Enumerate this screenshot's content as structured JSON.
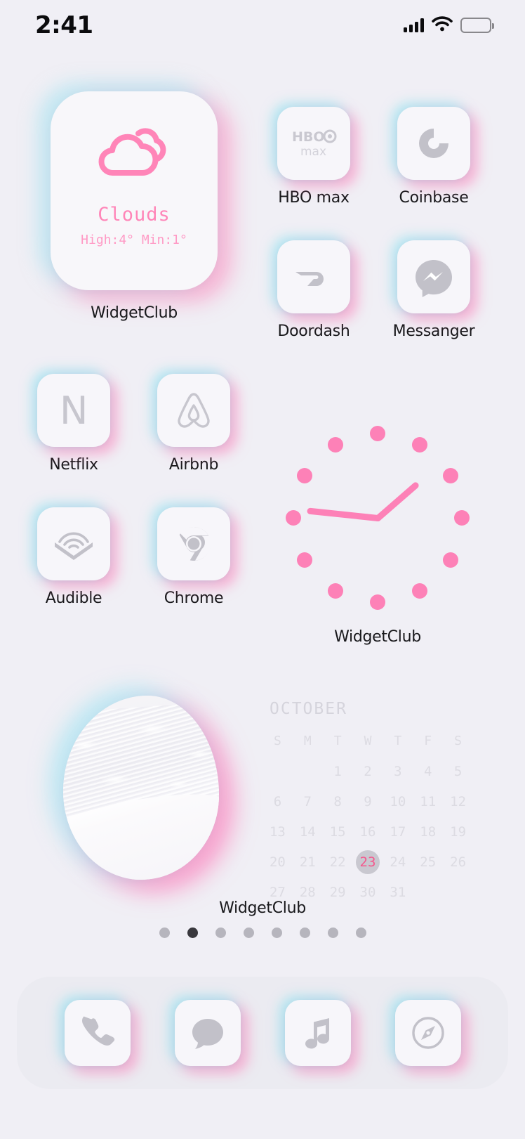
{
  "status_bar": {
    "time": "2:41",
    "signal_icon": "cellular-signal-icon",
    "wifi_icon": "wifi-icon",
    "battery_icon": "battery-icon"
  },
  "weather_widget": {
    "icon": "clouds-icon",
    "condition": "Clouds",
    "temps": "High:4° Min:1°",
    "label": "WidgetClub",
    "accent_color": "#ff85b8"
  },
  "clock_widget": {
    "label": "WidgetClub",
    "dot_color": "#fd81b7",
    "hand_color": "#fd81b7",
    "hour_markers": 12,
    "minute_hand_deg": 186,
    "hour_hand_deg": -41
  },
  "photo_calendar_widget": {
    "label": "WidgetClub",
    "photo_name": "beach-wave-photo",
    "calendar": {
      "month": "OCTOBER",
      "weekday_headers": [
        "S",
        "M",
        "T",
        "W",
        "T",
        "F",
        "S"
      ],
      "leading_blanks": 2,
      "days": [
        1,
        2,
        3,
        4,
        5,
        6,
        7,
        8,
        9,
        10,
        11,
        12,
        13,
        14,
        15,
        16,
        17,
        18,
        19,
        20,
        21,
        22,
        23,
        24,
        25,
        26,
        27,
        28,
        29,
        30,
        31
      ],
      "today": 23,
      "today_text_color": "#f4588d",
      "today_circle_color": "#c9c8d0",
      "day_color": "#dcdbe2"
    }
  },
  "apps": [
    {
      "label": "HBO max",
      "icon": "hbo-max-icon"
    },
    {
      "label": "Coinbase",
      "icon": "coinbase-icon"
    },
    {
      "label": "Doordash",
      "icon": "doordash-icon"
    },
    {
      "label": "Messanger",
      "icon": "messenger-icon"
    },
    {
      "label": "Netflix",
      "icon": "netflix-icon"
    },
    {
      "label": "Airbnb",
      "icon": "airbnb-icon"
    },
    {
      "label": "Audible",
      "icon": "audible-icon"
    },
    {
      "label": "Chrome",
      "icon": "chrome-icon"
    }
  ],
  "page_indicator": {
    "total": 8,
    "active_index": 1
  },
  "dock": [
    {
      "name": "Phone",
      "icon": "phone-icon"
    },
    {
      "name": "Messages",
      "icon": "messages-icon"
    },
    {
      "name": "Music",
      "icon": "music-note-icon"
    },
    {
      "name": "Safari",
      "icon": "compass-icon"
    }
  ],
  "theme": {
    "background": "#f0eff5",
    "tile_background": "#f7f6fa",
    "glow_cyan": "#82e1f0",
    "glow_pink": "#ff78b4",
    "icon_gray": "#b9b8c0",
    "label_color": "#18181b"
  }
}
